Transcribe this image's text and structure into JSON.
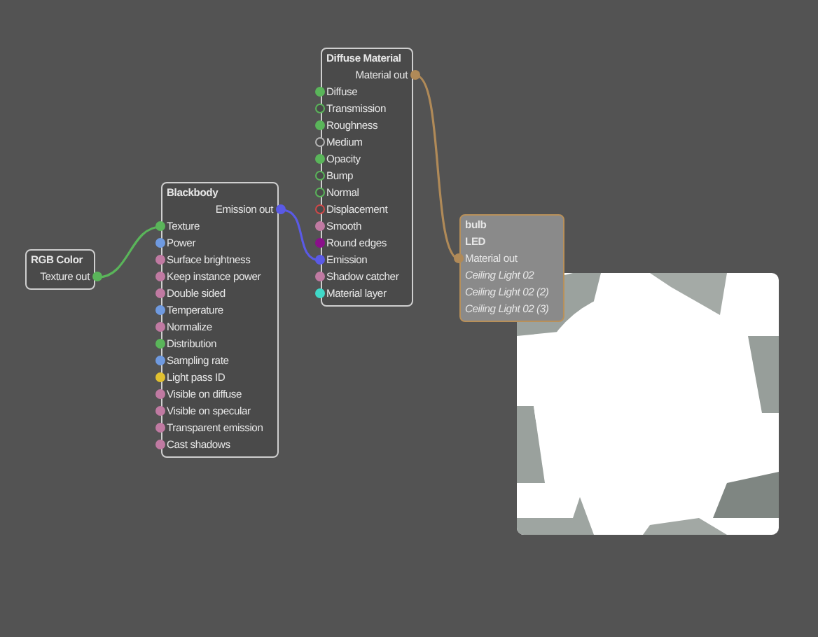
{
  "nodes": [
    {
      "title": "RGB Color",
      "selected": false,
      "output": {
        "label": "Texture out",
        "color": "#5ab55a"
      }
    },
    {
      "title": "Blackbody",
      "selected": false,
      "output": {
        "label": "Emission out",
        "color": "#5a5ae6"
      },
      "inputs": [
        {
          "label": "Texture",
          "color": "#5ab55a",
          "hollow": false,
          "connected": true
        },
        {
          "label": "Power",
          "color": "#6f9ae0",
          "hollow": false,
          "connected": false
        },
        {
          "label": "Surface brightness",
          "color": "#c07aa2",
          "hollow": false,
          "connected": false
        },
        {
          "label": "Keep instance power",
          "color": "#c07aa2",
          "hollow": false,
          "connected": false
        },
        {
          "label": "Double sided",
          "color": "#c07aa2",
          "hollow": false,
          "connected": false
        },
        {
          "label": "Temperature",
          "color": "#6f9ae0",
          "hollow": false,
          "connected": false
        },
        {
          "label": "Normalize",
          "color": "#c07aa2",
          "hollow": false,
          "connected": false
        },
        {
          "label": "Distribution",
          "color": "#5ab55a",
          "hollow": false,
          "connected": false
        },
        {
          "label": "Sampling rate",
          "color": "#6f9ae0",
          "hollow": false,
          "connected": false
        },
        {
          "label": "Light pass ID",
          "color": "#e0c030",
          "hollow": false,
          "connected": false
        },
        {
          "label": "Visible on diffuse",
          "color": "#c07aa2",
          "hollow": false,
          "connected": false
        },
        {
          "label": "Visible on specular",
          "color": "#c07aa2",
          "hollow": false,
          "connected": false
        },
        {
          "label": "Transparent emission",
          "color": "#c07aa2",
          "hollow": false,
          "connected": false
        },
        {
          "label": "Cast shadows",
          "color": "#c07aa2",
          "hollow": false,
          "connected": false
        }
      ]
    },
    {
      "title": "Diffuse Material",
      "selected": false,
      "output": {
        "label": "Material out",
        "color": "#b08a58"
      },
      "inputs": [
        {
          "label": "Diffuse",
          "color": "#5ab55a",
          "hollow": false,
          "connected": false
        },
        {
          "label": "Transmission",
          "color": "#5ab55a",
          "hollow": true,
          "connected": false
        },
        {
          "label": "Roughness",
          "color": "#5ab55a",
          "hollow": false,
          "connected": false
        },
        {
          "label": "Medium",
          "color": "#b4b4b4",
          "hollow": true,
          "connected": false
        },
        {
          "label": "Opacity",
          "color": "#5ab55a",
          "hollow": false,
          "connected": false
        },
        {
          "label": "Bump",
          "color": "#5ab55a",
          "hollow": true,
          "connected": false
        },
        {
          "label": "Normal",
          "color": "#5ab55a",
          "hollow": true,
          "connected": false
        },
        {
          "label": "Displacement",
          "color": "#d04848",
          "hollow": true,
          "connected": false
        },
        {
          "label": "Smooth",
          "color": "#c07aa2",
          "hollow": false,
          "connected": false
        },
        {
          "label": "Round edges",
          "color": "#8a108a",
          "hollow": false,
          "connected": false
        },
        {
          "label": "Emission",
          "color": "#5a5ae6",
          "hollow": false,
          "connected": true
        },
        {
          "label": "Shadow catcher",
          "color": "#c07aa2",
          "hollow": false,
          "connected": false
        },
        {
          "label": "Material layer",
          "color": "#40d8c8",
          "hollow": false,
          "connected": false
        }
      ]
    },
    {
      "title": "bulb",
      "subtitle": "LED",
      "selected": true,
      "inputs": [
        {
          "label": "Material out",
          "color": "#b08a58",
          "hollow": false,
          "connected": true
        }
      ],
      "items": [
        "Ceiling Light 02",
        "Ceiling Light 02 (2)",
        "Ceiling Light 02 (3)"
      ]
    }
  ]
}
